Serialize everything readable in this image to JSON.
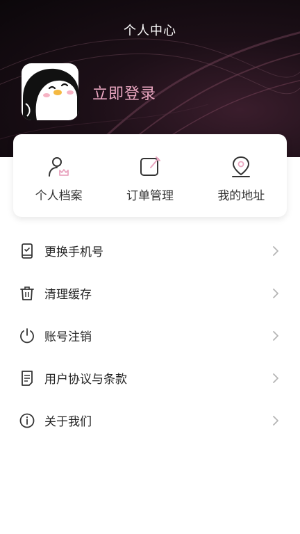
{
  "header": {
    "title": "个人中心",
    "login_text": "立即登录",
    "avatar_icon": "penguin-avatar"
  },
  "quick_actions": [
    {
      "label": "个人档案",
      "icon": "profile-icon"
    },
    {
      "label": "订单管理",
      "icon": "edit-order-icon"
    },
    {
      "label": "我的地址",
      "icon": "location-pin-icon"
    }
  ],
  "menu": [
    {
      "label": "更换手机号",
      "icon": "phone-icon"
    },
    {
      "label": "清理缓存",
      "icon": "trash-icon"
    },
    {
      "label": "账号注销",
      "icon": "power-icon"
    },
    {
      "label": "用户协议与条款",
      "icon": "document-icon"
    },
    {
      "label": "关于我们",
      "icon": "info-icon"
    }
  ],
  "colors": {
    "accent": "#e9a6c0",
    "header_dark": "#1c0f17"
  }
}
